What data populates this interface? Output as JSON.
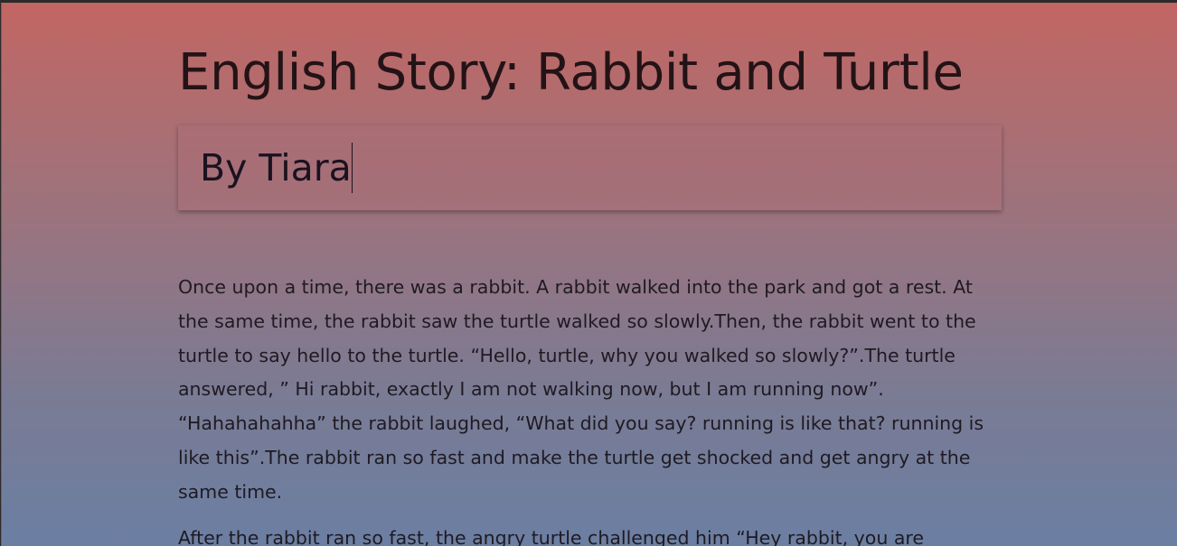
{
  "header": {
    "title": "English Story: Rabbit and Turtle",
    "byline": "By Tiara"
  },
  "story": {
    "paragraphs": [
      "Once upon a time, there was a rabbit. A rabbit walked into the park and got a rest. At the same time, the rabbit saw the turtle walked so slowly.Then, the rabbit went to the turtle to say hello to the turtle. “Hello, turtle, why you walked so slowly?”.The turtle answered, ” Hi rabbit, exactly I am not walking now, but I am running now”. “Hahahahahha” the rabbit laughed, “What did you say? running is like that? running is like this”.The rabbit ran so fast and make the turtle get shocked and get angry at the same time.",
      "After the rabbit ran so fast, the angry turtle challenged him “Hey rabbit, you are"
    ]
  },
  "colors": {
    "gradient_top": "#c26663",
    "gradient_bottom": "#6b7fa3",
    "text": "#1f1a22"
  }
}
